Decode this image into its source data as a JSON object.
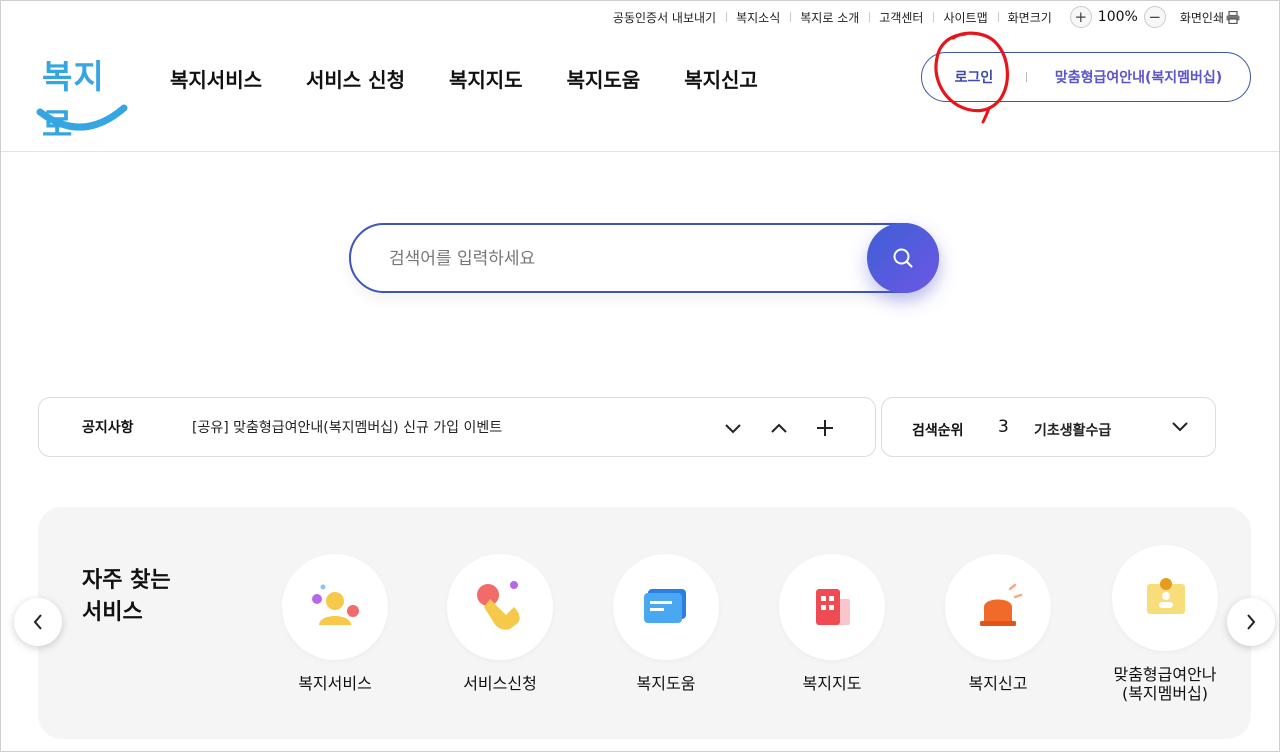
{
  "utility": {
    "links": [
      "공동인증서 내보내기",
      "복지소식",
      "복지로 소개",
      "고객센터",
      "사이트맵",
      "화면크기"
    ],
    "zoom_in_icon": "plus-icon",
    "zoom_value": "100%",
    "zoom_out_icon": "minus-icon",
    "print_label": "화면인쇄",
    "print_icon": "printer-icon"
  },
  "logo": {
    "text": "복지로",
    "color": "#35a6e2"
  },
  "gnb": {
    "items": [
      "복지서비스",
      "서비스 신청",
      "복지지도",
      "복지도움",
      "복지신고"
    ]
  },
  "auth": {
    "login_label": "로그인",
    "member_label": "맞춤형급여안내(복지멤버십)",
    "border_color": "#3c55a5"
  },
  "search": {
    "placeholder": "검색어를 입력하세요",
    "button_icon": "search-icon"
  },
  "notice": {
    "label": "공지사항",
    "text": "[공유] 맞춤형급여안내(복지멤버십) 신규 가입 이벤트",
    "next_icon": "chevron-down-icon",
    "prev_icon": "chevron-up-icon",
    "more_icon": "plus-icon"
  },
  "ranking": {
    "label": "검색순위",
    "rank": "3",
    "term": "기초생활수급",
    "toggle_icon": "chevron-down-icon"
  },
  "quick": {
    "title_line1": "자주 찾는",
    "title_line2": "서비스",
    "services": [
      {
        "label": "복지서비스",
        "icon": "person-icon"
      },
      {
        "label": "서비스신청",
        "icon": "hand-tap-icon"
      },
      {
        "label": "복지도움",
        "icon": "chat-bubble-icon"
      },
      {
        "label": "복지지도",
        "icon": "building-icon"
      },
      {
        "label": "복지신고",
        "icon": "siren-icon"
      },
      {
        "label_line1": "맞춤형급여안나",
        "label_line2": "(복지멤버십)",
        "icon": "id-badge-icon"
      }
    ],
    "prev_icon": "chevron-left-icon",
    "next_icon": "chevron-right-icon"
  }
}
